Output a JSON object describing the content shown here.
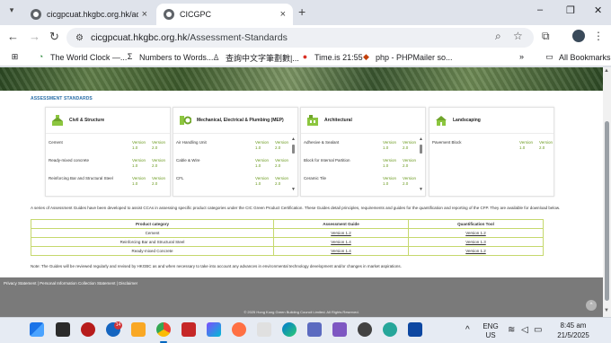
{
  "browser": {
    "tabs": [
      {
        "title": "cicgpcuat.hkgbc.org.hk/admin/i",
        "close": "×"
      },
      {
        "title": "CICGPC",
        "close": "×"
      }
    ],
    "new_tab": "+",
    "window_controls": {
      "minimize": "–",
      "restore": "❐",
      "close": "✕"
    },
    "nav": {
      "back": "←",
      "forward": "→",
      "reload": "↻"
    },
    "url_host": "cicgpcuat.hkgbc.org.hk",
    "url_path": "/Assessment-Standards",
    "bookmarks": [
      {
        "icon": "grid-icon",
        "label": ""
      },
      {
        "icon": "clock-icon",
        "label": "The World Clock —..."
      },
      {
        "icon": "sigma-icon",
        "label": "Numbers to Words..."
      },
      {
        "icon": "user-icon",
        "label": "查詢中文字筆劃數|..."
      },
      {
        "icon": "clock-icon",
        "label": "Time.is 21:55"
      },
      {
        "icon": "php-icon",
        "label": "php - PHPMailer so..."
      }
    ],
    "bookmarks_more": "»",
    "all_bookmarks": "All Bookmarks"
  },
  "page": {
    "section_title": "ASSESSMENT STANDARDS",
    "categories": [
      {
        "title": "Civil & Structure",
        "icon": "civil-structure-icon",
        "items": [
          {
            "name": "Cement",
            "v1": "Version 1.0",
            "v2": "Version 2.0"
          },
          {
            "name": "Ready-mixed concrete",
            "v1": "Version 1.0",
            "v2": "Version 2.0"
          },
          {
            "name": "Reinforcing Bar and Structural Steel",
            "v1": "Version 1.0",
            "v2": "Version 2.0"
          }
        ]
      },
      {
        "title": "Mechanical, Electrical & Plumbing (MEP)",
        "icon": "mep-icon",
        "items": [
          {
            "name": "Air Handling Unit",
            "v1": "Version 1.0",
            "v2": "Version 2.0"
          },
          {
            "name": "Cable & Wire",
            "v1": "Version 1.0",
            "v2": "Version 2.0"
          },
          {
            "name": "CFL",
            "v1": "Version 1.0",
            "v2": "Version 2.0"
          }
        ]
      },
      {
        "title": "Architectural",
        "icon": "architectural-icon",
        "items": [
          {
            "name": "Adhesive & Sealant",
            "v1": "Version 1.0",
            "v2": "Version 2.0"
          },
          {
            "name": "Block for Internal Partition",
            "v1": "Version 1.0",
            "v2": "Version 2.0"
          },
          {
            "name": "Ceramic Tile",
            "v1": "Version 1.0",
            "v2": "Version 2.0"
          }
        ]
      },
      {
        "title": "Landscaping",
        "icon": "landscaping-icon",
        "items": [
          {
            "name": "Pavement Block",
            "v1": "Version 1.0",
            "v2": "Version 2.0"
          }
        ]
      }
    ],
    "intro": "A series of Assessment Guides have been developed to assist CCAs in assessing specific product categories under the CIC Green Product Certification. These Guides detail principles, requirements and guides for the quantification and reporting of the CFP. They are available for download below.",
    "table": {
      "headers": [
        "Product category",
        "Assessment Guide",
        "Quantification Tool"
      ],
      "rows": [
        [
          "Cement",
          "Version 1.2",
          "Version 1.2"
        ],
        [
          "Reinforcing Bar and Structural Steel",
          "Version 1.4",
          "Version 1.3"
        ],
        [
          "Ready-mixed Concrete",
          "Version 1.4",
          "Version 1.2"
        ]
      ]
    },
    "note": "Note: The Guides will be reviewed regularly and revised by HKGBC as and when necessary to take into account any advances in environmental technology development and/or changes in market aspirations.",
    "footer_links": "Privacy Statement | Personal Information Collection Statement | Disclaimer",
    "copyright": "© 2025 Hong Kong Green Building Council Limited. All Rights Reserved.",
    "to_top": "^"
  },
  "taskbar": {
    "badge": "14",
    "lang": "ENG",
    "region": "US",
    "time": "8:45 am",
    "date": "21/5/2025",
    "chevron": "^"
  },
  "colors": {
    "link_blue": "#2a6fa8",
    "version_green": "#6b9a20",
    "table_border": "#c5d86d",
    "footer_grey": "#7a7a7a"
  }
}
